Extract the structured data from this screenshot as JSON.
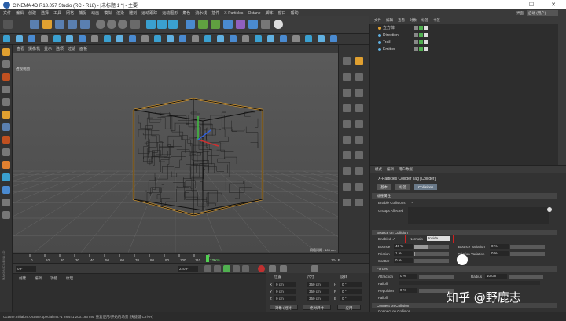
{
  "window": {
    "title": "CINEMA 4D R18.057 Studio (RC - R18) - [未标题 1 *] - 主要",
    "controls": [
      "—",
      "☐",
      "✕"
    ]
  },
  "menubar": {
    "items": [
      "文件",
      "编辑",
      "创建",
      "选择",
      "工具",
      "网格",
      "捕捉",
      "动画",
      "模拟",
      "渲染",
      "雕刻",
      "运动跟踪",
      "运动图形",
      "角色",
      "流水线",
      "插件",
      "X-Particles",
      "Octane",
      "脚本",
      "窗口",
      "帮助"
    ],
    "layout_label": "界面",
    "layout_value": "启动 (用户)"
  },
  "viewport": {
    "menu": [
      "查看",
      "摄像机",
      "显示",
      "选项",
      "过滤",
      "面板"
    ],
    "label": "透视视图",
    "grid_info": "网格间距 : 100 cm"
  },
  "timeline": {
    "ticks": [
      "0",
      "10",
      "20",
      "30",
      "40",
      "50",
      "60",
      "70",
      "80",
      "90",
      "100",
      "110",
      "120"
    ],
    "current_frame": "12400",
    "end_label": "124 F"
  },
  "transport": {
    "start_field": "0 F",
    "end_field": "220 F",
    "current_field": "0 F"
  },
  "material_manager": {
    "menu": [
      "创建",
      "编辑",
      "功能",
      "纹理"
    ]
  },
  "coords": {
    "headers": [
      "位置",
      "尺寸",
      "旋转"
    ],
    "rows": [
      {
        "axis": "X",
        "pos": "0 cm",
        "size": "350 cm",
        "rot_axis": "H",
        "rot": "0 °"
      },
      {
        "axis": "Y",
        "pos": "0 cm",
        "size": "350 cm",
        "rot_axis": "P",
        "rot": "0 °"
      },
      {
        "axis": "Z",
        "pos": "0 cm",
        "size": "350 cm",
        "rot_axis": "B",
        "rot": "0 °"
      }
    ],
    "mode_button": "对象 (相对)",
    "size_button": "绝对尺寸",
    "apply_button": "应用"
  },
  "statusbar": {
    "text": "Octane:Initialize.Octane:special  Init:-1 mes=1 200.196 ms.                 重复使用/开始的场景 [快捷键 Ctrl+R]"
  },
  "object_manager": {
    "menu": [
      "文件",
      "编辑",
      "查看",
      "对象",
      "标签",
      "书签"
    ],
    "objects": [
      {
        "name": "立方体",
        "color": "#e0a030"
      },
      {
        "name": "Direction",
        "color": "#60b0e0"
      },
      {
        "name": "Trail",
        "color": "#60b0e0"
      },
      {
        "name": "Emitter",
        "color": "#60b0e0"
      }
    ]
  },
  "attributes": {
    "menu": [
      "模式",
      "编辑",
      "用户数据"
    ],
    "title": "X-Particles Collider Tag [Collider]",
    "tabs": [
      "基本",
      "标签",
      "Collisions"
    ],
    "active_tab": "Collisions",
    "section_collision": "碰撞属性",
    "enable_collisions_label": "Enable Collisions",
    "enable_collisions_value": "✓",
    "groups_affected_label": "Groups Affected",
    "section_bounce": "Bounce on Collision",
    "enabled_label": "Enabled",
    "enabled_value": "✓",
    "normals_label": "Normals",
    "normals_value": "Inside",
    "bounce_label": "Bounce",
    "bounce_value": "40 %",
    "bounce_slider": 0.4,
    "bounce_var_label": "Bounce Variation",
    "bounce_var_value": "0 %",
    "friction_label": "Friction",
    "friction_value": "1 %",
    "friction_slider": 0.01,
    "friction_var_label": "Friction Variation",
    "friction_var_value": "0 %",
    "scatter_label": "Scatter",
    "scatter_value": "0 %",
    "section_forces": "Forces",
    "attraction_label": "Attraction",
    "attraction_value": "0 %",
    "radius_label": "Radius",
    "radius_value": "10 cm",
    "falloff_label": "Falloff",
    "repulsion_label": "Repulsion",
    "repulsion_value": "0 %",
    "section_connect": "Connect on Collision",
    "connect_label": "Connect on Collision"
  },
  "watermark": {
    "text": "知乎 @野鹿志"
  },
  "colors": {
    "accent": "#e0a030",
    "highlight_red": "#d02020",
    "panel_bg": "#323232"
  }
}
